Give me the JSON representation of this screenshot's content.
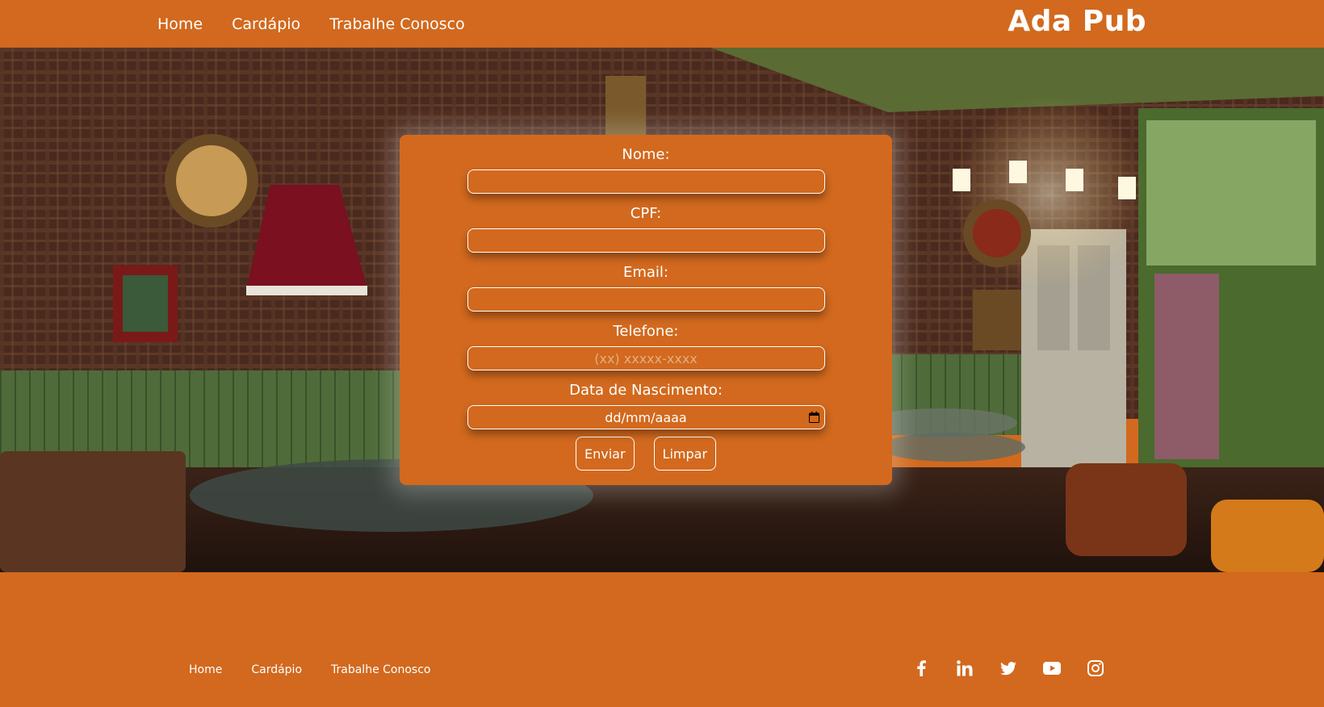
{
  "header": {
    "nav": [
      "Home",
      "Cardápio",
      "Trabalhe Conosco"
    ],
    "brand": "Ada Pub"
  },
  "form": {
    "fields": [
      {
        "label": "Nome:",
        "value": "",
        "placeholder": ""
      },
      {
        "label": "CPF:",
        "value": "",
        "placeholder": ""
      },
      {
        "label": "Email:",
        "value": "",
        "placeholder": ""
      },
      {
        "label": "Telefone:",
        "value": "",
        "placeholder": "(xx) xxxxx-xxxx"
      },
      {
        "label": "Data de Nascimento:",
        "value": "dd/mm/aaaa",
        "placeholder": ""
      }
    ],
    "submit_label": "Enviar",
    "reset_label": "Limpar"
  },
  "footer": {
    "nav": [
      "Home",
      "Cardápio",
      "Trabalhe Conosco"
    ],
    "social_icons": [
      "facebook-icon",
      "linkedin-icon",
      "twitter-icon",
      "youtube-icon",
      "instagram-icon"
    ]
  },
  "colors": {
    "brand_orange": "#d2691e",
    "text": "#ffffff"
  }
}
